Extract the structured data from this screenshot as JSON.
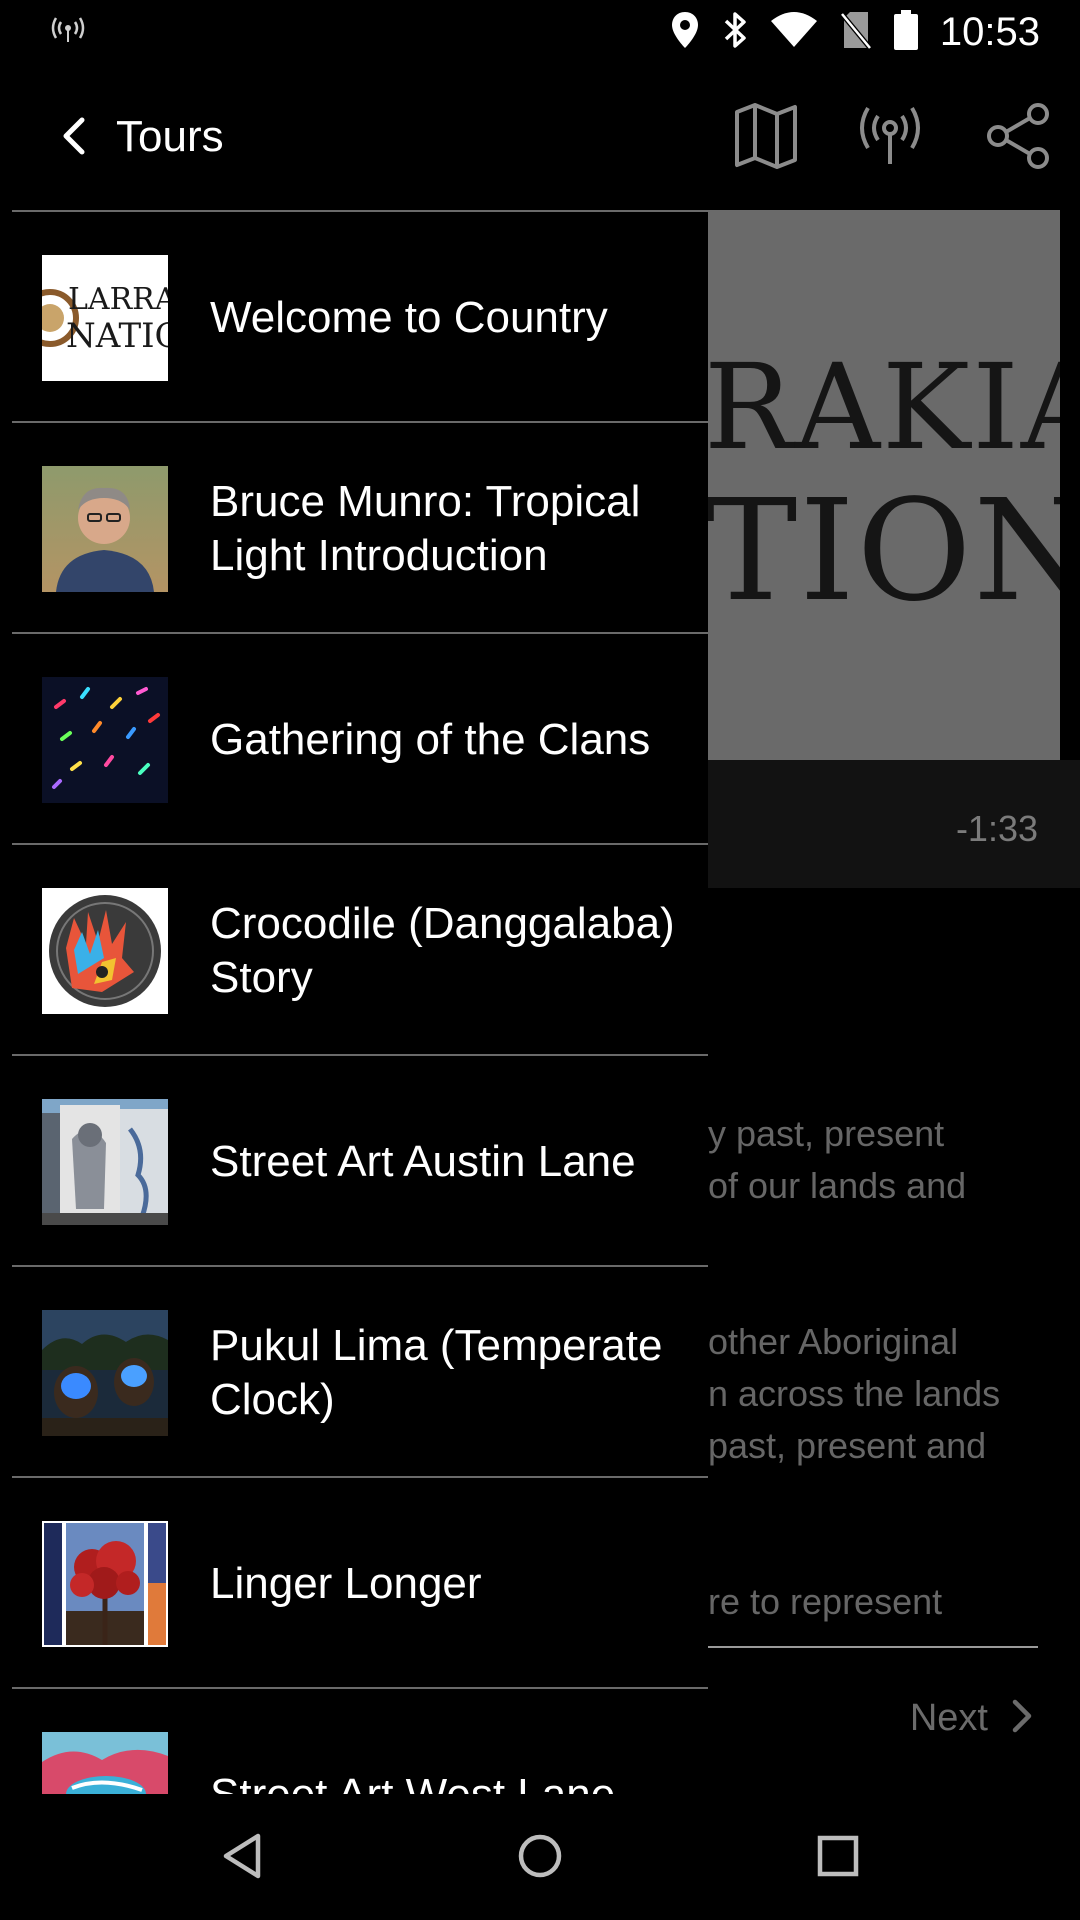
{
  "status_bar": {
    "time": "10:53",
    "icons": [
      "hotspot-icon",
      "location-icon",
      "bluetooth-icon",
      "wifi-icon",
      "no-sim-icon",
      "battery-icon"
    ]
  },
  "toolbar": {
    "title": "Tours",
    "icons": [
      "back-icon",
      "map-icon",
      "broadcast-icon",
      "share-icon"
    ]
  },
  "background": {
    "image_text_line1": "RAKIA",
    "image_text_line2": "TION",
    "time_remaining": "-1:33",
    "text_block1": [
      "y past, present",
      "of our lands and"
    ],
    "text_block2": [
      "other Aboriginal",
      "n across the lands",
      "past, present and"
    ],
    "text_block3": [
      "re to represent"
    ],
    "next_label": "Next"
  },
  "drawer": {
    "tours": [
      {
        "label": "Welcome to Country",
        "thumb": "larrakia-logo"
      },
      {
        "label": "Bruce Munro: Tropical Light Introduction",
        "thumb": "portrait-photo"
      },
      {
        "label": "Gathering of the Clans",
        "thumb": "night-lights-photo"
      },
      {
        "label": "Crocodile (Danggalaba) Story",
        "thumb": "crocodile-hand-artwork"
      },
      {
        "label": "Street Art Austin Lane",
        "thumb": "mural-photo"
      },
      {
        "label": "Pukul Lima (Temperate Clock)",
        "thumb": "glowing-spheres-photo"
      },
      {
        "label": "Linger Longer",
        "thumb": "tree-photo"
      },
      {
        "label": "Street Art West Lane",
        "thumb": "painted-mural-photo"
      }
    ]
  },
  "nav_bar": {
    "icons": [
      "back-triangle-icon",
      "home-circle-icon",
      "recents-square-icon"
    ]
  },
  "colors": {
    "background": "#000000",
    "divider": "#6a6a6a",
    "dim_text": "#666666",
    "image_overlay": "#6a6a6a"
  }
}
